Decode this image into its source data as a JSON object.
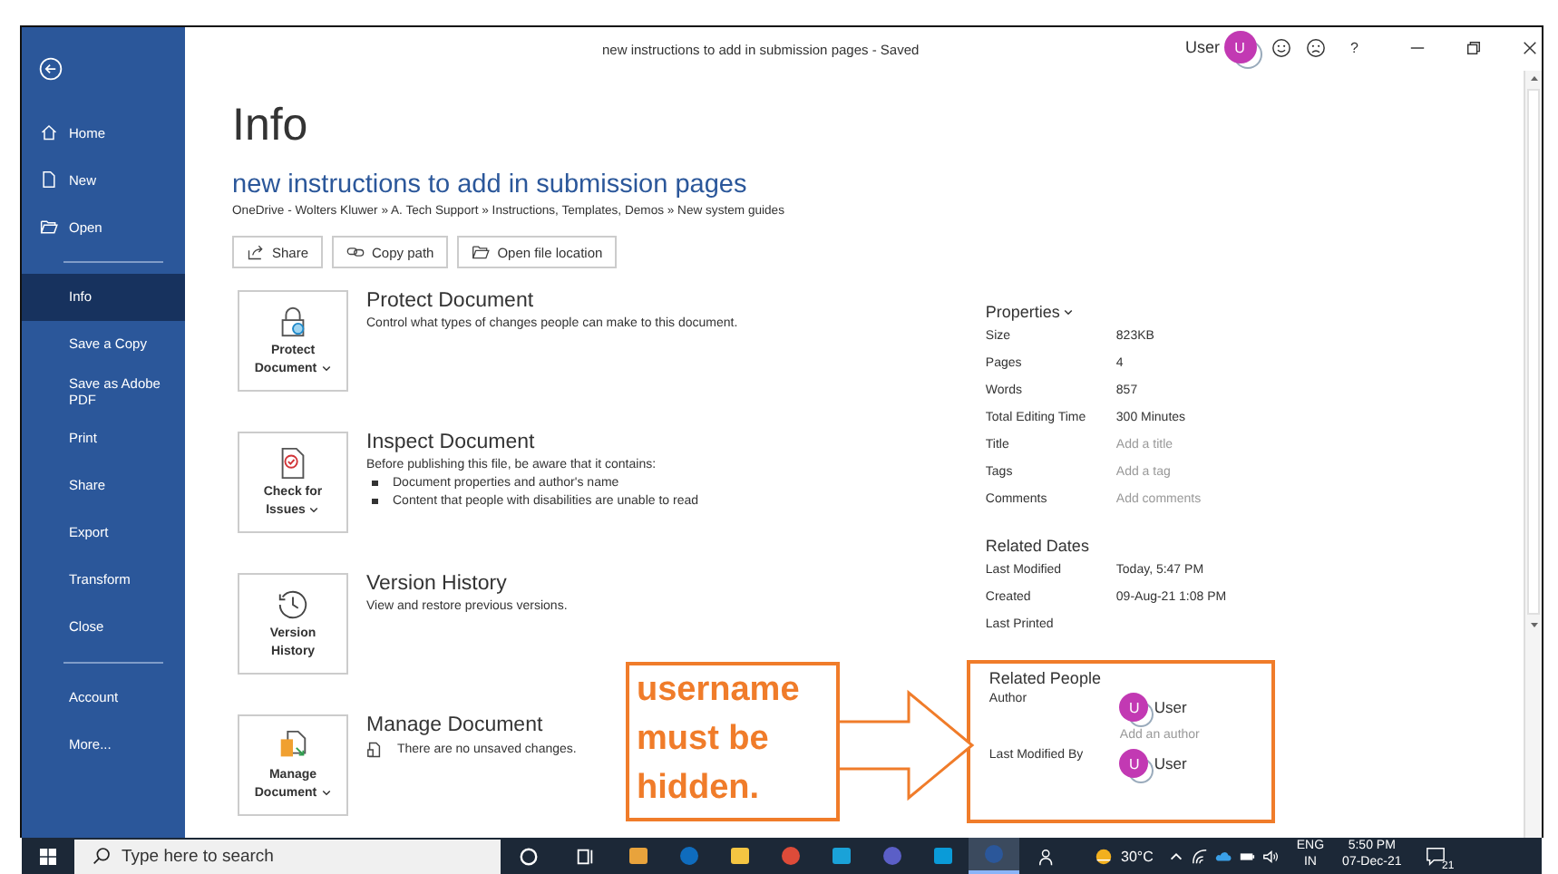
{
  "window": {
    "title": "new instructions to add in submission pages  -  Saved",
    "user": "User",
    "avatar": "U",
    "help": "?"
  },
  "sidebar": {
    "nav": [
      {
        "label": "Home",
        "selected": false
      },
      {
        "label": "New",
        "selected": false
      },
      {
        "label": "Open",
        "selected": false
      }
    ],
    "items": [
      {
        "label": "Info",
        "selected": true
      },
      {
        "label": "Save a Copy",
        "selected": false
      },
      {
        "label": "Save as Adobe PDF",
        "selected": false
      },
      {
        "label": "Print",
        "selected": false
      },
      {
        "label": "Share",
        "selected": false
      },
      {
        "label": "Export",
        "selected": false
      },
      {
        "label": "Transform",
        "selected": false
      },
      {
        "label": "Close",
        "selected": false
      }
    ],
    "footer": [
      {
        "label": "Account",
        "selected": false
      },
      {
        "label": "More...",
        "selected": false
      }
    ]
  },
  "page": {
    "heading": "Info",
    "doc_title": "new instructions to add in submission pages",
    "path": "OneDrive - Wolters Kluwer » A. Tech Support » Instructions, Templates, Demos » New system guides",
    "actions": [
      "Share",
      "Copy path",
      "Open file location"
    ]
  },
  "sections": [
    {
      "button": "Protect Document",
      "menu": true,
      "title": "Protect Document",
      "description": "Control what types of changes people can make to this document."
    },
    {
      "button": "Check for Issues",
      "menu": true,
      "title": "Inspect Document",
      "description": "Before publishing this file, be aware that it contains:",
      "bullets": [
        "Document properties and author's name",
        "Content that people with disabilities are unable to read"
      ]
    },
    {
      "button": "Version History",
      "menu": false,
      "title": "Version History",
      "description": "View and restore previous versions."
    },
    {
      "button": "Manage Document",
      "menu": true,
      "title": "Manage Document",
      "note": "There are no unsaved changes."
    }
  ],
  "properties": {
    "heading": "Properties",
    "rows": [
      {
        "label": "Size",
        "value": "823KB",
        "muted": false
      },
      {
        "label": "Pages",
        "value": "4",
        "muted": false
      },
      {
        "label": "Words",
        "value": "857",
        "muted": false
      },
      {
        "label": "Total Editing Time",
        "value": "300 Minutes",
        "muted": false
      },
      {
        "label": "Title",
        "value": "Add a title",
        "muted": true
      },
      {
        "label": "Tags",
        "value": "Add a tag",
        "muted": true
      },
      {
        "label": "Comments",
        "value": "Add comments",
        "muted": true
      }
    ]
  },
  "related_dates": {
    "heading": "Related Dates",
    "rows": [
      {
        "label": "Last Modified",
        "value": "Today, 5:47 PM",
        "muted": false
      },
      {
        "label": "Created",
        "value": "09-Aug-21 1:08 PM",
        "muted": false
      },
      {
        "label": "Last Printed"
      }
    ]
  },
  "related_people": {
    "heading": "Related People",
    "highlighted": true,
    "author": {
      "label": "Author",
      "name": "User",
      "initial": "U",
      "add": "Add an author"
    },
    "modified_by": {
      "label": "Last Modified By",
      "name": "User",
      "initial": "U"
    }
  },
  "annotation": {
    "text": "username must be hidden."
  },
  "taskbar": {
    "search_placeholder": "Type here to search",
    "apps": [
      {
        "active": false
      },
      {
        "active": false
      },
      {
        "active": false
      },
      {
        "active": false
      },
      {
        "active": false
      },
      {
        "active": false
      },
      {
        "active": false
      },
      {
        "active": true
      }
    ],
    "weather": "30°C",
    "language": [
      "ENG",
      "IN"
    ],
    "time": "5:50 PM",
    "date": "07-Dec-21",
    "notifications": "21"
  }
}
